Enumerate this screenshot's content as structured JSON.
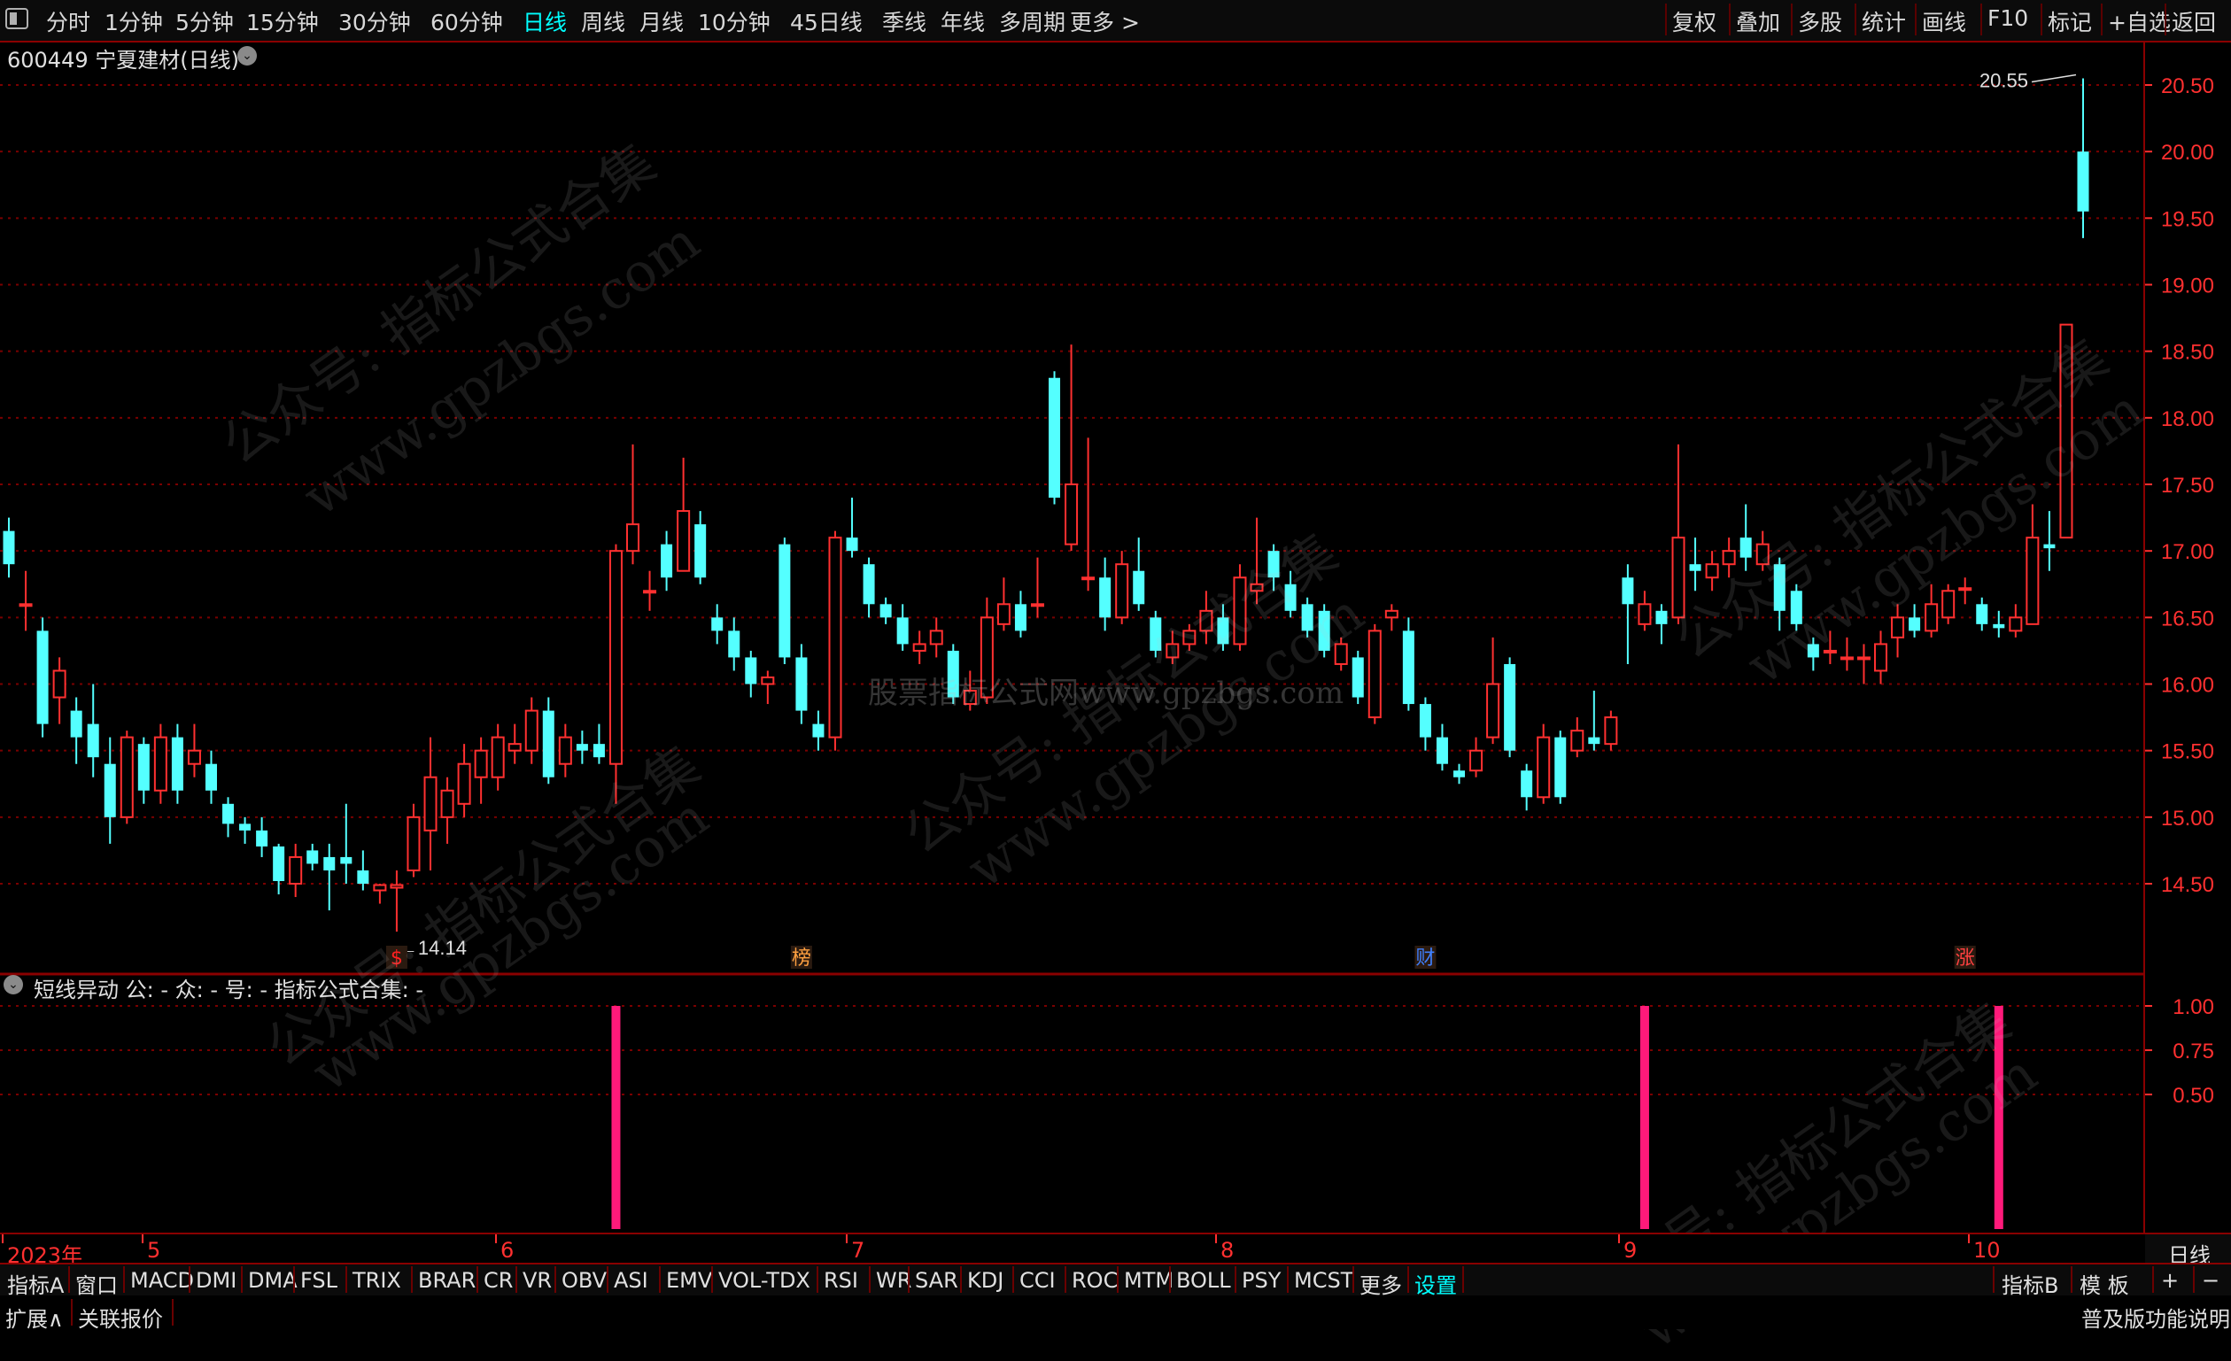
{
  "toolbar": {
    "periods": [
      "分时",
      "1分钟",
      "5分钟",
      "15分钟",
      "30分钟",
      "60分钟",
      "日线",
      "周线",
      "月线",
      "10分钟",
      "45日线",
      "季线",
      "年线",
      "多周期",
      "更多 >"
    ],
    "active_period": "日线",
    "actions": [
      "复权",
      "叠加",
      "多股",
      "统计",
      "画线",
      "F10",
      "标记",
      "+自选",
      "返回"
    ]
  },
  "stock": {
    "title": "600449 宁夏建材(日线)"
  },
  "main_chart": {
    "price_axis": [
      "20.50",
      "20.00",
      "19.50",
      "19.00",
      "18.50",
      "18.00",
      "17.50",
      "17.00",
      "16.50",
      "16.00",
      "15.50",
      "15.00",
      "14.50"
    ],
    "high_label": "20.55",
    "low_label": "←14.14",
    "event_markers": [
      {
        "label": "$",
        "color": "#ff2020",
        "index": 23
      },
      {
        "label": "榜",
        "color": "#ffa040",
        "index": 47
      },
      {
        "label": "财",
        "color": "#4080ff",
        "index": 84
      },
      {
        "label": "涨",
        "color": "#ff4040",
        "index": 116
      }
    ],
    "watermark_center": "股票指标公式网www.gpzbgs.com"
  },
  "chart_data": {
    "type": "candlestick",
    "ylim": [
      14.1,
      20.9
    ],
    "candles": [
      [
        17.15,
        16.9,
        17.25,
        16.8
      ],
      [
        16.6,
        16.6,
        16.85,
        16.4
      ],
      [
        16.4,
        15.7,
        16.5,
        15.6
      ],
      [
        15.9,
        16.1,
        16.2,
        15.7
      ],
      [
        15.8,
        15.6,
        15.9,
        15.4
      ],
      [
        15.7,
        15.45,
        16.0,
        15.3
      ],
      [
        15.4,
        15.0,
        15.6,
        14.8
      ],
      [
        15.0,
        15.6,
        15.65,
        14.95
      ],
      [
        15.55,
        15.2,
        15.6,
        15.1
      ],
      [
        15.2,
        15.6,
        15.7,
        15.1
      ],
      [
        15.6,
        15.2,
        15.7,
        15.1
      ],
      [
        15.4,
        15.5,
        15.7,
        15.3
      ],
      [
        15.4,
        15.2,
        15.5,
        15.1
      ],
      [
        15.1,
        14.95,
        15.15,
        14.85
      ],
      [
        14.95,
        14.9,
        15.0,
        14.8
      ],
      [
        14.9,
        14.78,
        15.0,
        14.7
      ],
      [
        14.78,
        14.52,
        14.8,
        14.42
      ],
      [
        14.5,
        14.7,
        14.8,
        14.4
      ],
      [
        14.75,
        14.65,
        14.8,
        14.6
      ],
      [
        14.7,
        14.6,
        14.8,
        14.3
      ],
      [
        14.7,
        14.65,
        15.1,
        14.5
      ],
      [
        14.6,
        14.5,
        14.75,
        14.45
      ],
      [
        14.45,
        14.49,
        14.5,
        14.35
      ],
      [
        14.47,
        14.49,
        14.6,
        14.14
      ],
      [
        14.6,
        15.0,
        15.1,
        14.55
      ],
      [
        14.9,
        15.3,
        15.6,
        14.6
      ],
      [
        15.0,
        15.2,
        15.3,
        14.8
      ],
      [
        15.1,
        15.4,
        15.55,
        15.0
      ],
      [
        15.3,
        15.5,
        15.6,
        15.1
      ],
      [
        15.3,
        15.6,
        15.7,
        15.2
      ],
      [
        15.5,
        15.55,
        15.7,
        15.4
      ],
      [
        15.5,
        15.8,
        15.9,
        15.4
      ],
      [
        15.8,
        15.3,
        15.9,
        15.25
      ],
      [
        15.4,
        15.6,
        15.7,
        15.3
      ],
      [
        15.55,
        15.5,
        15.65,
        15.4
      ],
      [
        15.55,
        15.45,
        15.7,
        15.4
      ],
      [
        15.4,
        17.0,
        17.05,
        15.1
      ],
      [
        17.0,
        17.2,
        17.8,
        16.9
      ],
      [
        16.7,
        16.7,
        16.85,
        16.55
      ],
      [
        17.05,
        16.8,
        17.15,
        16.7
      ],
      [
        16.85,
        17.3,
        17.7,
        16.9
      ],
      [
        17.2,
        16.8,
        17.3,
        16.75
      ],
      [
        16.5,
        16.4,
        16.6,
        16.3
      ],
      [
        16.4,
        16.2,
        16.5,
        16.1
      ],
      [
        16.2,
        16.0,
        16.25,
        15.9
      ],
      [
        16.0,
        16.05,
        16.1,
        15.85
      ],
      [
        17.05,
        16.2,
        17.1,
        16.15
      ],
      [
        16.2,
        15.8,
        16.3,
        15.7
      ],
      [
        15.7,
        15.6,
        15.8,
        15.5
      ],
      [
        15.6,
        17.1,
        17.15,
        15.5
      ],
      [
        17.1,
        17.0,
        17.4,
        16.95
      ],
      [
        16.9,
        16.6,
        16.95,
        16.5
      ],
      [
        16.6,
        16.5,
        16.65,
        16.45
      ],
      [
        16.5,
        16.3,
        16.6,
        16.25
      ],
      [
        16.25,
        16.3,
        16.4,
        16.15
      ],
      [
        16.3,
        16.4,
        16.5,
        16.2
      ],
      [
        16.25,
        15.9,
        16.3,
        15.85
      ],
      [
        15.85,
        15.95,
        16.1,
        15.8
      ],
      [
        15.9,
        16.5,
        16.65,
        15.85
      ],
      [
        16.45,
        16.6,
        16.8,
        16.4
      ],
      [
        16.6,
        16.4,
        16.7,
        16.35
      ],
      [
        16.6,
        16.6,
        16.95,
        16.5
      ],
      [
        18.3,
        17.4,
        18.35,
        17.35
      ],
      [
        17.05,
        17.5,
        18.55,
        17.0
      ],
      [
        16.8,
        16.8,
        17.85,
        16.7
      ],
      [
        16.8,
        16.5,
        16.95,
        16.4
      ],
      [
        16.5,
        16.9,
        17.0,
        16.45
      ],
      [
        16.85,
        16.6,
        17.1,
        16.55
      ],
      [
        16.5,
        16.25,
        16.55,
        16.2
      ],
      [
        16.2,
        16.3,
        16.4,
        16.15
      ],
      [
        16.3,
        16.4,
        16.45,
        16.25
      ],
      [
        16.4,
        16.55,
        16.7,
        16.3
      ],
      [
        16.5,
        16.3,
        16.6,
        16.25
      ],
      [
        16.3,
        16.8,
        16.9,
        16.25
      ],
      [
        16.7,
        16.75,
        17.25,
        16.6
      ],
      [
        17.0,
        16.8,
        17.05,
        16.7
      ],
      [
        16.75,
        16.55,
        16.85,
        16.5
      ],
      [
        16.6,
        16.4,
        16.65,
        16.35
      ],
      [
        16.55,
        16.25,
        16.6,
        16.2
      ],
      [
        16.15,
        16.3,
        16.35,
        16.1
      ],
      [
        16.2,
        15.9,
        16.25,
        15.85
      ],
      [
        15.75,
        16.4,
        16.45,
        15.7
      ],
      [
        16.5,
        16.55,
        16.6,
        16.4
      ],
      [
        16.4,
        15.85,
        16.5,
        15.8
      ],
      [
        15.85,
        15.6,
        15.9,
        15.5
      ],
      [
        15.6,
        15.4,
        15.7,
        15.35
      ],
      [
        15.35,
        15.3,
        15.4,
        15.25
      ],
      [
        15.35,
        15.5,
        15.6,
        15.3
      ],
      [
        15.6,
        16.0,
        16.35,
        15.55
      ],
      [
        16.15,
        15.5,
        16.2,
        15.45
      ],
      [
        15.35,
        15.15,
        15.4,
        15.05
      ],
      [
        15.15,
        15.6,
        15.7,
        15.1
      ],
      [
        15.6,
        15.15,
        15.65,
        15.1
      ],
      [
        15.5,
        15.65,
        15.75,
        15.45
      ],
      [
        15.6,
        15.55,
        15.95,
        15.5
      ],
      [
        15.55,
        15.75,
        15.8,
        15.5
      ],
      [
        16.8,
        16.6,
        16.9,
        16.15
      ],
      [
        16.45,
        16.6,
        16.7,
        16.4
      ],
      [
        16.55,
        16.45,
        16.6,
        16.3
      ],
      [
        16.5,
        17.1,
        17.8,
        16.45
      ],
      [
        16.9,
        16.85,
        17.1,
        16.7
      ],
      [
        16.8,
        16.9,
        17.0,
        16.7
      ],
      [
        16.9,
        17.0,
        17.1,
        16.8
      ],
      [
        17.1,
        16.95,
        17.35,
        16.85
      ],
      [
        16.9,
        17.05,
        17.15,
        16.85
      ],
      [
        16.9,
        16.55,
        16.95,
        16.4
      ],
      [
        16.7,
        16.45,
        16.75,
        16.4
      ],
      [
        16.3,
        16.2,
        16.35,
        16.1
      ],
      [
        16.25,
        16.25,
        16.4,
        16.15
      ],
      [
        16.2,
        16.2,
        16.35,
        16.1
      ],
      [
        16.2,
        16.2,
        16.3,
        16.0
      ],
      [
        16.1,
        16.3,
        16.4,
        16.0
      ],
      [
        16.35,
        16.5,
        16.6,
        16.2
      ],
      [
        16.5,
        16.4,
        16.6,
        16.35
      ],
      [
        16.4,
        16.6,
        16.75,
        16.35
      ],
      [
        16.5,
        16.7,
        16.75,
        16.45
      ],
      [
        16.72,
        16.72,
        16.8,
        16.6
      ],
      [
        16.6,
        16.45,
        16.65,
        16.4
      ],
      [
        16.45,
        16.42,
        16.55,
        16.35
      ],
      [
        16.4,
        16.5,
        16.6,
        16.35
      ],
      [
        16.45,
        17.1,
        17.35,
        16.45
      ],
      [
        17.05,
        17.02,
        17.3,
        16.85
      ],
      [
        17.1,
        18.7,
        18.7,
        17.1
      ],
      [
        20.0,
        19.55,
        20.55,
        19.35
      ]
    ],
    "indicator": {
      "name": "短线异动",
      "yaxis": [
        "1.00",
        "0.75",
        "0.50"
      ],
      "signals_at": [
        36,
        97,
        118
      ]
    }
  },
  "sub_chart": {
    "title": "短线异动 公: - 众: - 号: - 指标公式合集: -"
  },
  "time_axis": {
    "labels": [
      {
        "text": "2023年",
        "x": 8
      },
      {
        "text": "5",
        "x": 166
      },
      {
        "text": "6",
        "x": 565
      },
      {
        "text": "7",
        "x": 961
      },
      {
        "text": "8",
        "x": 1378
      },
      {
        "text": "9",
        "x": 1833
      },
      {
        "text": "10",
        "x": 2228
      }
    ],
    "right_label": "日线"
  },
  "indicator_bar": {
    "items": [
      "指标A",
      "窗口",
      "MACD",
      "DMI",
      "DMA",
      "FSL",
      "TRIX",
      "BRAR",
      "CR",
      "VR",
      "OBV",
      "ASI",
      "EMV",
      "VOL-TDX",
      "RSI",
      "WR",
      "SAR",
      "KDJ",
      "CCI",
      "ROC",
      "MTM",
      "BOLL",
      "PSY",
      "MCST",
      "更多",
      "设置"
    ],
    "highlight": "设置",
    "right_items": [
      "指标B",
      "模 板",
      "+",
      "−"
    ]
  },
  "bottom_bar": {
    "left_items": [
      "扩展∧",
      "关联报价"
    ],
    "right_text": "普及版功能说明"
  },
  "watermark_text": "公众号: 指标公式合集",
  "watermark_url": "www.gpzbgs.com",
  "colors": {
    "up": "#ff3030",
    "down": "#54ffff",
    "grid": "#7a0000",
    "signal": "#ff1a7a",
    "axis": "#ff3030"
  }
}
